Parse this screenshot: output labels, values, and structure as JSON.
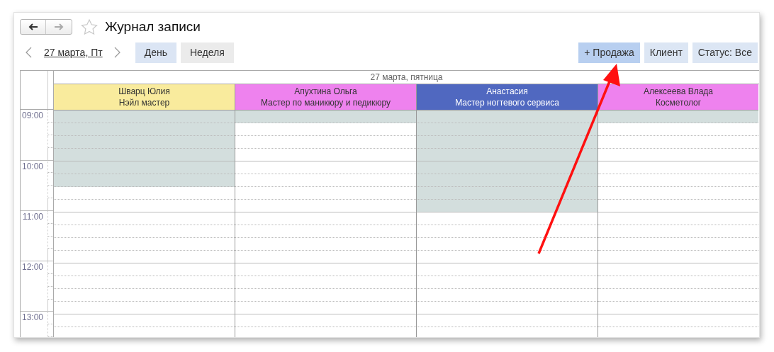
{
  "window": {
    "title": "Журнал записи",
    "favorite": false
  },
  "date_nav": {
    "date": "27 марта, Пт"
  },
  "view_tabs": [
    {
      "label": "День",
      "selected": true
    },
    {
      "label": "Неделя",
      "selected": false
    }
  ],
  "actions": [
    {
      "label": "+ Продажа",
      "kind": "primary"
    },
    {
      "label": "Клиент",
      "kind": "secondary"
    },
    {
      "label": "Статус: Все",
      "kind": "secondary"
    }
  ],
  "schedule": {
    "day_header": "27 марта, пятница",
    "hours": [
      "09:00",
      "10:00",
      "11:00",
      "12:00",
      "13:00"
    ],
    "staff": [
      {
        "name": "Шварц Юлия",
        "role": "Нэйл мастер",
        "color": "#f9eb9d",
        "busy_slots": [
          true,
          true,
          true,
          true,
          true,
          true,
          false,
          false,
          false,
          false,
          false,
          false,
          false,
          false,
          false,
          false,
          false,
          false
        ]
      },
      {
        "name": "Апухтина Ольга",
        "role": "Мастер по маникюру и педикюру",
        "color": "#ee82ee",
        "busy_slots": [
          true,
          false,
          false,
          false,
          false,
          false,
          false,
          false,
          false,
          false,
          false,
          false,
          false,
          false,
          false,
          false,
          false,
          false
        ]
      },
      {
        "name": "Анастасия",
        "role": "Мастер ногтевого сервиса",
        "color": "#5068c0",
        "busy_slots": [
          true,
          true,
          true,
          true,
          true,
          true,
          true,
          true,
          false,
          false,
          false,
          false,
          false,
          false,
          false,
          false,
          false,
          false
        ]
      },
      {
        "name": "Алексеева Влада",
        "role": "Косметолог",
        "color": "#ee82ee",
        "busy_slots": [
          true,
          false,
          false,
          false,
          false,
          false,
          false,
          false,
          false,
          false,
          false,
          false,
          false,
          false,
          false,
          false,
          false,
          false
        ]
      }
    ]
  }
}
